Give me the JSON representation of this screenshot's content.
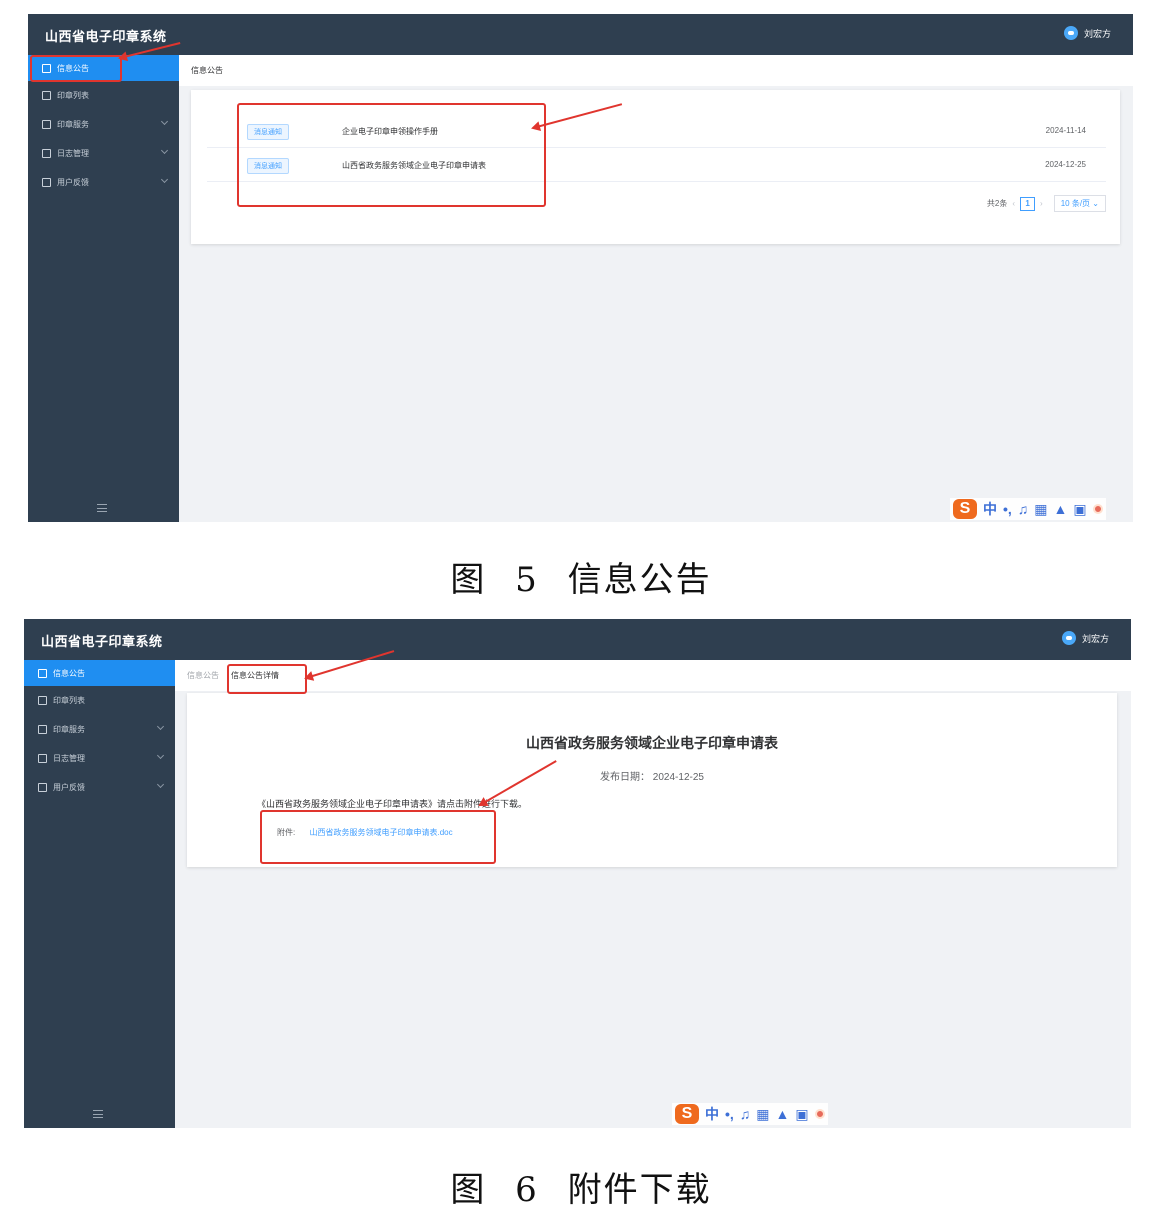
{
  "app": {
    "title": "山西省电子印章系统",
    "user": "刘宏方"
  },
  "sidebar": {
    "items": [
      {
        "label": "信息公告"
      },
      {
        "label": "印章列表"
      },
      {
        "label": "印章服务"
      },
      {
        "label": "日志管理"
      },
      {
        "label": "用户反馈"
      }
    ]
  },
  "screen1": {
    "breadcrumb": "信息公告",
    "rows": [
      {
        "badge": "消息通知",
        "title": "企业电子印章申领操作手册",
        "date": "2024-11-14"
      },
      {
        "badge": "消息通知",
        "title": "山西省政务服务领域企业电子印章申请表",
        "date": "2024-12-25"
      }
    ],
    "pager": {
      "total": "共2条",
      "current": "1",
      "size": "10 条/页"
    }
  },
  "screen2": {
    "breadcrumb_parent": "信息公告",
    "breadcrumb_current": "信息公告详情",
    "title": "山西省政务服务领域企业电子印章申请表",
    "date_line": "发布日期： 2024-12-25",
    "body": "《山西省政务服务领域企业电子印章申请表》请点击附件进行下载。",
    "attachment_label": "附件:",
    "attachment_file": "山西省政务服务领域电子印章申请表.doc"
  },
  "ime": {
    "lang": "中"
  },
  "captions": {
    "fig5": "图 5 信息公告",
    "fig6": "图 6 附件下载"
  },
  "colors": {
    "topbar": "#2f3f50",
    "active": "#1f8ef1",
    "highlight": "#e0352e",
    "link": "#409eff"
  }
}
